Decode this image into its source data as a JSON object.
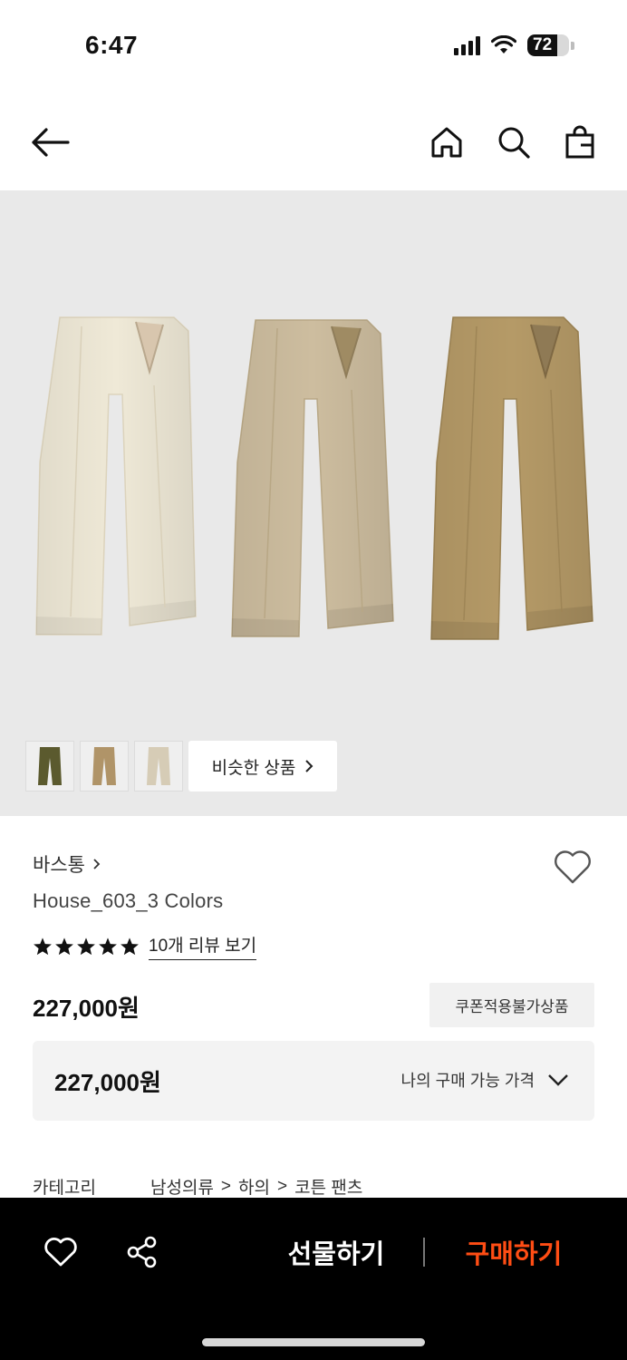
{
  "status_bar": {
    "time": "6:47",
    "battery_percent": 72,
    "battery_label": "72"
  },
  "nav": {
    "icons": [
      "back-arrow-icon",
      "home-icon",
      "search-icon",
      "shopping-bag-icon"
    ]
  },
  "gallery": {
    "pant_colors": [
      "#efe9d7",
      "#cdbd9f",
      "#b59a67"
    ],
    "thumbnail_colors": [
      "#5b5a2e",
      "#b09468",
      "#d6ccb6"
    ],
    "similar_label": "비슷한 상품"
  },
  "product": {
    "brand": "바스통",
    "name": "House_603_3 Colors",
    "rating_stars": 5,
    "review_link": "10개 리뷰 보기",
    "price": "227,000원",
    "coupon_badge": "쿠폰적용불가상품",
    "my_price_value": "227,000원",
    "my_price_label": "나의 구매 가능 가격"
  },
  "category": {
    "label": "카테고리",
    "path": [
      "남성의류",
      "하의",
      "코튼 팬츠"
    ]
  },
  "bottom_bar": {
    "gift_label": "선물하기",
    "buy_label": "구매하기",
    "buy_color": "#ff4d14"
  }
}
